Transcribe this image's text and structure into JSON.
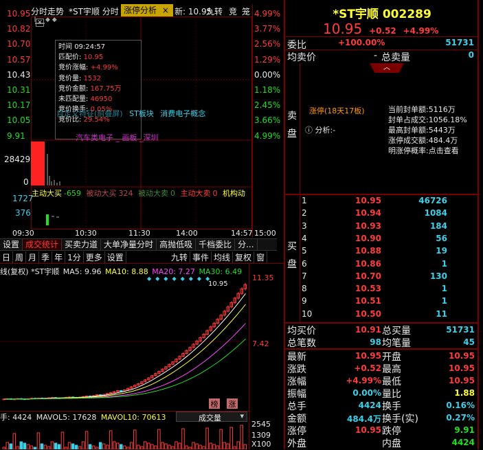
{
  "top_tabs": {
    "intraday": "分时走势",
    "stock_tab": "*ST宇顺 分时",
    "active_tab": "涨停分析",
    "close": "×",
    "news": "新: 10.95",
    "jiuzhuan": "九转",
    "jing": "竞",
    "long": "笼"
  },
  "price_axis": [
    {
      "price": "10.95",
      "pct": "4.99%",
      "color": "#ff3b3b"
    },
    {
      "price": "10.82",
      "pct": "3.77%",
      "color": "#ff3b3b"
    },
    {
      "price": "10.70",
      "pct": "2.56%",
      "color": "#ff3b3b"
    },
    {
      "price": "10.57",
      "pct": "1.29%",
      "color": "#ff3b3b"
    },
    {
      "price": "10.43",
      "pct": "0.00%",
      "color": "#e8e8e8"
    },
    {
      "price": "10.31",
      "pct": "1.18%",
      "color": "#22dd22"
    },
    {
      "price": "10.17",
      "pct": "2.45%",
      "color": "#22dd22"
    },
    {
      "price": "10.05",
      "pct": "3.66%",
      "color": "#22dd22"
    },
    {
      "price": "9.91",
      "pct": "4.99%",
      "color": "#22dd22"
    }
  ],
  "vol_axis": [
    "28429",
    "0"
  ],
  "flow_axis": [
    "1727",
    "376"
  ],
  "info_popup": {
    "time_label": "时间",
    "time": "09:24:57",
    "match_price_label": "匹配价:",
    "match_price": "10.95",
    "bid_change_label": "竞价涨幅:",
    "bid_change": "+4.99%",
    "bid_vol_label": "竞价量:",
    "bid_vol": "1532",
    "bid_amt_label": "竞价金额:",
    "bid_amt": "167.75万",
    "unmatched_label": "未匹配量:",
    "unmatched": "46950",
    "bid_turnover_label": "竞价换手:",
    "bid_turnover": "0.05%",
    "prev_change_label": "竞价比:",
    "prev_change": "29.54%"
  },
  "overlay": {
    "screen": "自定义特征(前叠屏)",
    "sector": "ST板块",
    "concept": "消费电子概念",
    "region": "汽车类电子 _ 画板 _深圳"
  },
  "flow_bar": {
    "main_buy_label": "主动大买",
    "main_buy": "-659",
    "passive_buy_label": "被动大买",
    "passive_buy": "324",
    "passive_sell_label": "被动大卖",
    "passive_sell": "0",
    "main_sell_label": "主动大卖",
    "main_sell": "0",
    "inst_label": "机构动"
  },
  "time_axis": [
    "09:30",
    "10:30",
    "11:30",
    "14:00",
    "14:57",
    "15:00"
  ],
  "left_tabs": [
    "设置",
    "成交统计",
    "买卖力道",
    "大单净量分时",
    "高抛低吸",
    "千档委比",
    "分..."
  ],
  "kline_toolbar": [
    "日",
    "周",
    "月",
    "季",
    "年",
    "1分",
    "更多",
    "设置"
  ],
  "kline_toolbar_right": [
    "九转",
    "事件",
    "均线",
    "复权",
    "窗"
  ],
  "ma_bar": {
    "prefix": "线(复权) *ST宇顺",
    "ma5": "MA5: 9.96",
    "ma10": "MA10: 8.88",
    "ma20": "MA20: 7.27",
    "ma30": "MA30: 6.49"
  },
  "kline_axis": {
    "top": "11.35",
    "mid": "7.42",
    "price_tag": "10.95"
  },
  "kline_badges": {
    "bang": "榜",
    "zhang": "涨"
  },
  "kline_series": {
    "closes": [
      3.5,
      3.52,
      3.48,
      3.5,
      3.53,
      3.51,
      3.49,
      3.52,
      3.55,
      3.54,
      3.56,
      3.53,
      3.55,
      3.58,
      3.6,
      3.57,
      3.55,
      3.58,
      3.61,
      3.63,
      3.6,
      3.58,
      3.62,
      3.66,
      3.7,
      3.68,
      3.72,
      3.78,
      3.75,
      3.8,
      3.86,
      3.92,
      3.98,
      4.05,
      4.0,
      4.1,
      4.2,
      4.3,
      4.4,
      4.5,
      4.62,
      4.75,
      4.88,
      5.02,
      5.16,
      5.3,
      5.45,
      5.6,
      5.76,
      5.92,
      6.1,
      6.28,
      6.47,
      6.66,
      6.86,
      7.07,
      7.28,
      7.5,
      7.72,
      7.96,
      8.2,
      8.44,
      8.7,
      8.96,
      9.22,
      9.5,
      9.78,
      10.07,
      10.37,
      10.67,
      10.95
    ]
  },
  "vol_bar": {
    "prefix": "手: 4424",
    "mavol5": "MAVOL5: 17628",
    "mavol10": "MAVOL10: 70613",
    "select": "成交量"
  },
  "vol_axis_k": [
    "2545",
    "1309",
    "X100"
  ],
  "stock": {
    "name": "*ST宇顺 002289",
    "price": "10.95",
    "change": "+0.52",
    "pct": "+4.99%"
  },
  "weibi": {
    "label": "委比",
    "value": "+100.00%",
    "count": "51731"
  },
  "avg_row": {
    "label": "均卖价",
    "value": "-",
    "total_label": "总卖量",
    "total": "0"
  },
  "limit_panel": {
    "side_label": "卖盘",
    "limit_tag": "涨停(18天17板)",
    "analysis_label": "分析:",
    "analysis": "-",
    "stats": [
      {
        "label": "当前封单额:",
        "value": "5116万"
      },
      {
        "label": "封单占成交:",
        "value": "1056.18%"
      },
      {
        "label": "最高封单额:",
        "value": "5443万"
      },
      {
        "label": "涨停成交额:",
        "value": "484.4万"
      },
      {
        "label": "明涨停概率:",
        "value": "点击查看"
      }
    ]
  },
  "buy_side_label": "买盘",
  "bids": [
    {
      "lvl": "1",
      "price": "10.95",
      "vol": "46726"
    },
    {
      "lvl": "2",
      "price": "10.94",
      "vol": "1084"
    },
    {
      "lvl": "3",
      "price": "10.93",
      "vol": "184"
    },
    {
      "lvl": "4",
      "price": "10.90",
      "vol": "56"
    },
    {
      "lvl": "5",
      "price": "10.88",
      "vol": "19"
    },
    {
      "lvl": "6",
      "price": "10.86",
      "vol": "1"
    },
    {
      "lvl": "7",
      "price": "10.70",
      "vol": "130"
    },
    {
      "lvl": "8",
      "price": "10.53",
      "vol": "1"
    },
    {
      "lvl": "9",
      "price": "10.51",
      "vol": "1"
    },
    {
      "lvl": "10",
      "price": "10.50",
      "vol": "11"
    }
  ],
  "summary1": [
    {
      "l": "均买价",
      "v": "10.91",
      "l2": "总买量",
      "v2": "51731"
    },
    {
      "l": "总笔数",
      "v": "98",
      "l2": "均笔量",
      "v2": "45"
    }
  ],
  "quote": [
    {
      "l": "最新",
      "v": "10.95",
      "vc": "#ff3b3b",
      "l2": "开盘",
      "v2": "10.95",
      "v2c": "#ff3b3b"
    },
    {
      "l": "涨跌",
      "v": "+0.52",
      "vc": "#ff3b3b",
      "l2": "最高",
      "v2": "10.95",
      "v2c": "#ff3b3b"
    },
    {
      "l": "涨幅",
      "v": "+4.99%",
      "vc": "#ff3b3b",
      "l2": "最低",
      "v2": "10.95",
      "v2c": "#ff3b3b"
    },
    {
      "l": "振幅",
      "v": "0.00%",
      "vc": "#3ad0e8",
      "l2": "量比",
      "v2": "1.88",
      "v2c": "#ffff33"
    },
    {
      "l": "总手",
      "v": "4424",
      "vc": "#3ad0e8",
      "l2": "换手",
      "v2": "0.16%",
      "v2c": "#3ad0e8"
    },
    {
      "l": "金额",
      "v": "484.4万",
      "vc": "#3ad0e8",
      "l2": "换手(实)",
      "v2": "0.27%",
      "v2c": "#3ad0e8"
    },
    {
      "l": "涨停",
      "v": "10.95",
      "vc": "#ff3b3b",
      "l2": "跌停",
      "v2": "9.91",
      "v2c": "#22dd22"
    },
    {
      "l": "外盘",
      "v": "",
      "vc": "#ff3b3b",
      "l2": "内盘",
      "v2": "4424",
      "v2c": "#22dd22"
    }
  ],
  "colors": {
    "up": "#ff3b3b",
    "down": "#22dd22",
    "frame": "#7a0000"
  }
}
